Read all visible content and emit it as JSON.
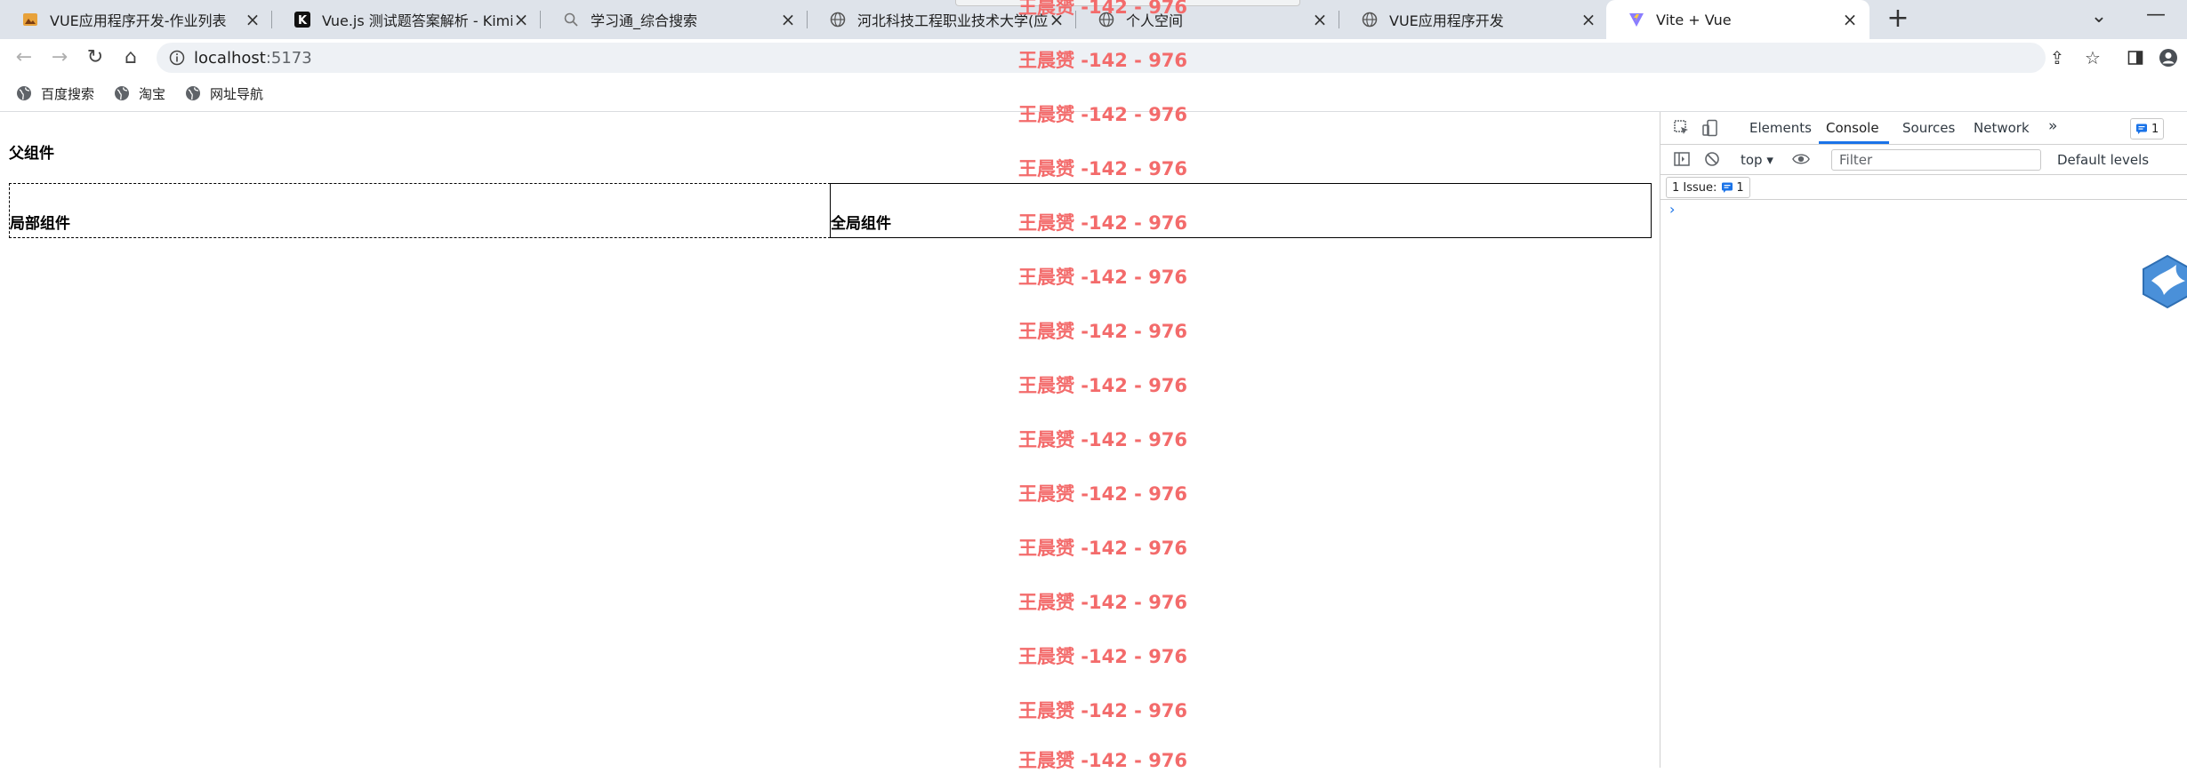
{
  "tabs": [
    {
      "title": "VUE应用程序开发-作业列表",
      "icon": "image-favicon-icon"
    },
    {
      "title": "Vue.js 测试题答案解析 - Kimi.ai",
      "icon": "kimi-favicon-icon"
    },
    {
      "title": "学习通_综合搜索",
      "icon": "search-favicon-icon"
    },
    {
      "title": "河北科技工程职业技术大学(应用",
      "icon": "globe-favicon-icon"
    },
    {
      "title": "个人空间",
      "icon": "globe-favicon-icon"
    },
    {
      "title": "VUE应用程序开发",
      "icon": "globe-favicon-icon"
    },
    {
      "title": "Vite + Vue",
      "icon": "vite-favicon-icon",
      "active": true
    }
  ],
  "toolbar": {
    "url_host": "localhost",
    "url_port": ":5173"
  },
  "bookmarks": [
    {
      "label": "百度搜索"
    },
    {
      "label": "淘宝"
    },
    {
      "label": "网址导航"
    }
  ],
  "page": {
    "parent_title": "父组件",
    "local_label": "局部组件",
    "global_label": "全局组件"
  },
  "watermark": {
    "text": "王晨赟 -142 - 976",
    "color": "#f36b6b"
  },
  "devtools": {
    "tabs": [
      "Elements",
      "Console",
      "Sources",
      "Network"
    ],
    "active_tab": "Console",
    "more": "»",
    "badge_count": "1",
    "context": "top",
    "filter_placeholder": "Filter",
    "levels": "Default levels",
    "issues_label": "1 Issue:",
    "issues_count": "1",
    "prompt": "›"
  },
  "colors": {
    "tabstrip": "#dee3ea",
    "accent": "#1a73e8"
  }
}
